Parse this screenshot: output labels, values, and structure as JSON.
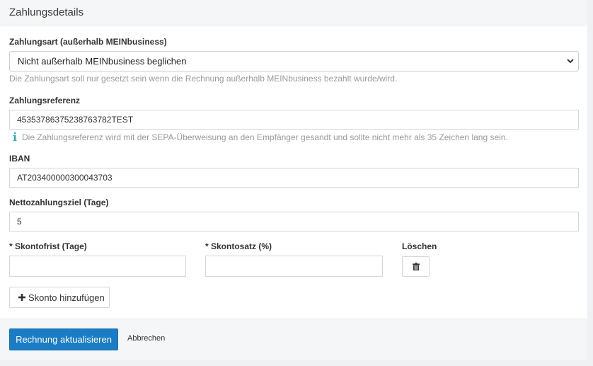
{
  "header": {
    "title": "Zahlungsdetails"
  },
  "payment_method": {
    "label": "Zahlungsart (außerhalb MEINbusiness)",
    "selected": "Nicht außerhalb MEINbusiness beglichen",
    "help": "Die Zahlungsart soll nur gesetzt sein wenn die Rechnung außerhalb MEINbusiness bezahlt wurde/wird."
  },
  "payment_reference": {
    "label": "Zahlungsreferenz",
    "value": "45353786375238763782TEST",
    "help": "Die Zahlungsreferenz wird mit der SEPA-Überweisung an den Empfänger gesandt und sollte nicht mehr als 35 Zeichen lang sein."
  },
  "iban": {
    "label": "IBAN",
    "value": "AT203400000300043703"
  },
  "net_payment_term": {
    "label": "Nettozahlungsziel (Tage)",
    "value": "5"
  },
  "discount": {
    "period_label": "* Skontofrist (Tage)",
    "period_value": "",
    "rate_label": "* Skontosatz (%)",
    "rate_value": "",
    "delete_label": "Löschen",
    "add_label": "Skonto hinzufügen"
  },
  "footer": {
    "submit_label": "Rechnung aktualisieren",
    "cancel_label": "Abbrechen"
  },
  "icons": {
    "select": "chevron-down-icon",
    "info": "info-icon",
    "delete": "trash-icon",
    "add": "plus-icon"
  },
  "colors": {
    "primary": "#1a7cc4",
    "info": "#2aa7c9",
    "header_bg": "#f5f6f8"
  }
}
